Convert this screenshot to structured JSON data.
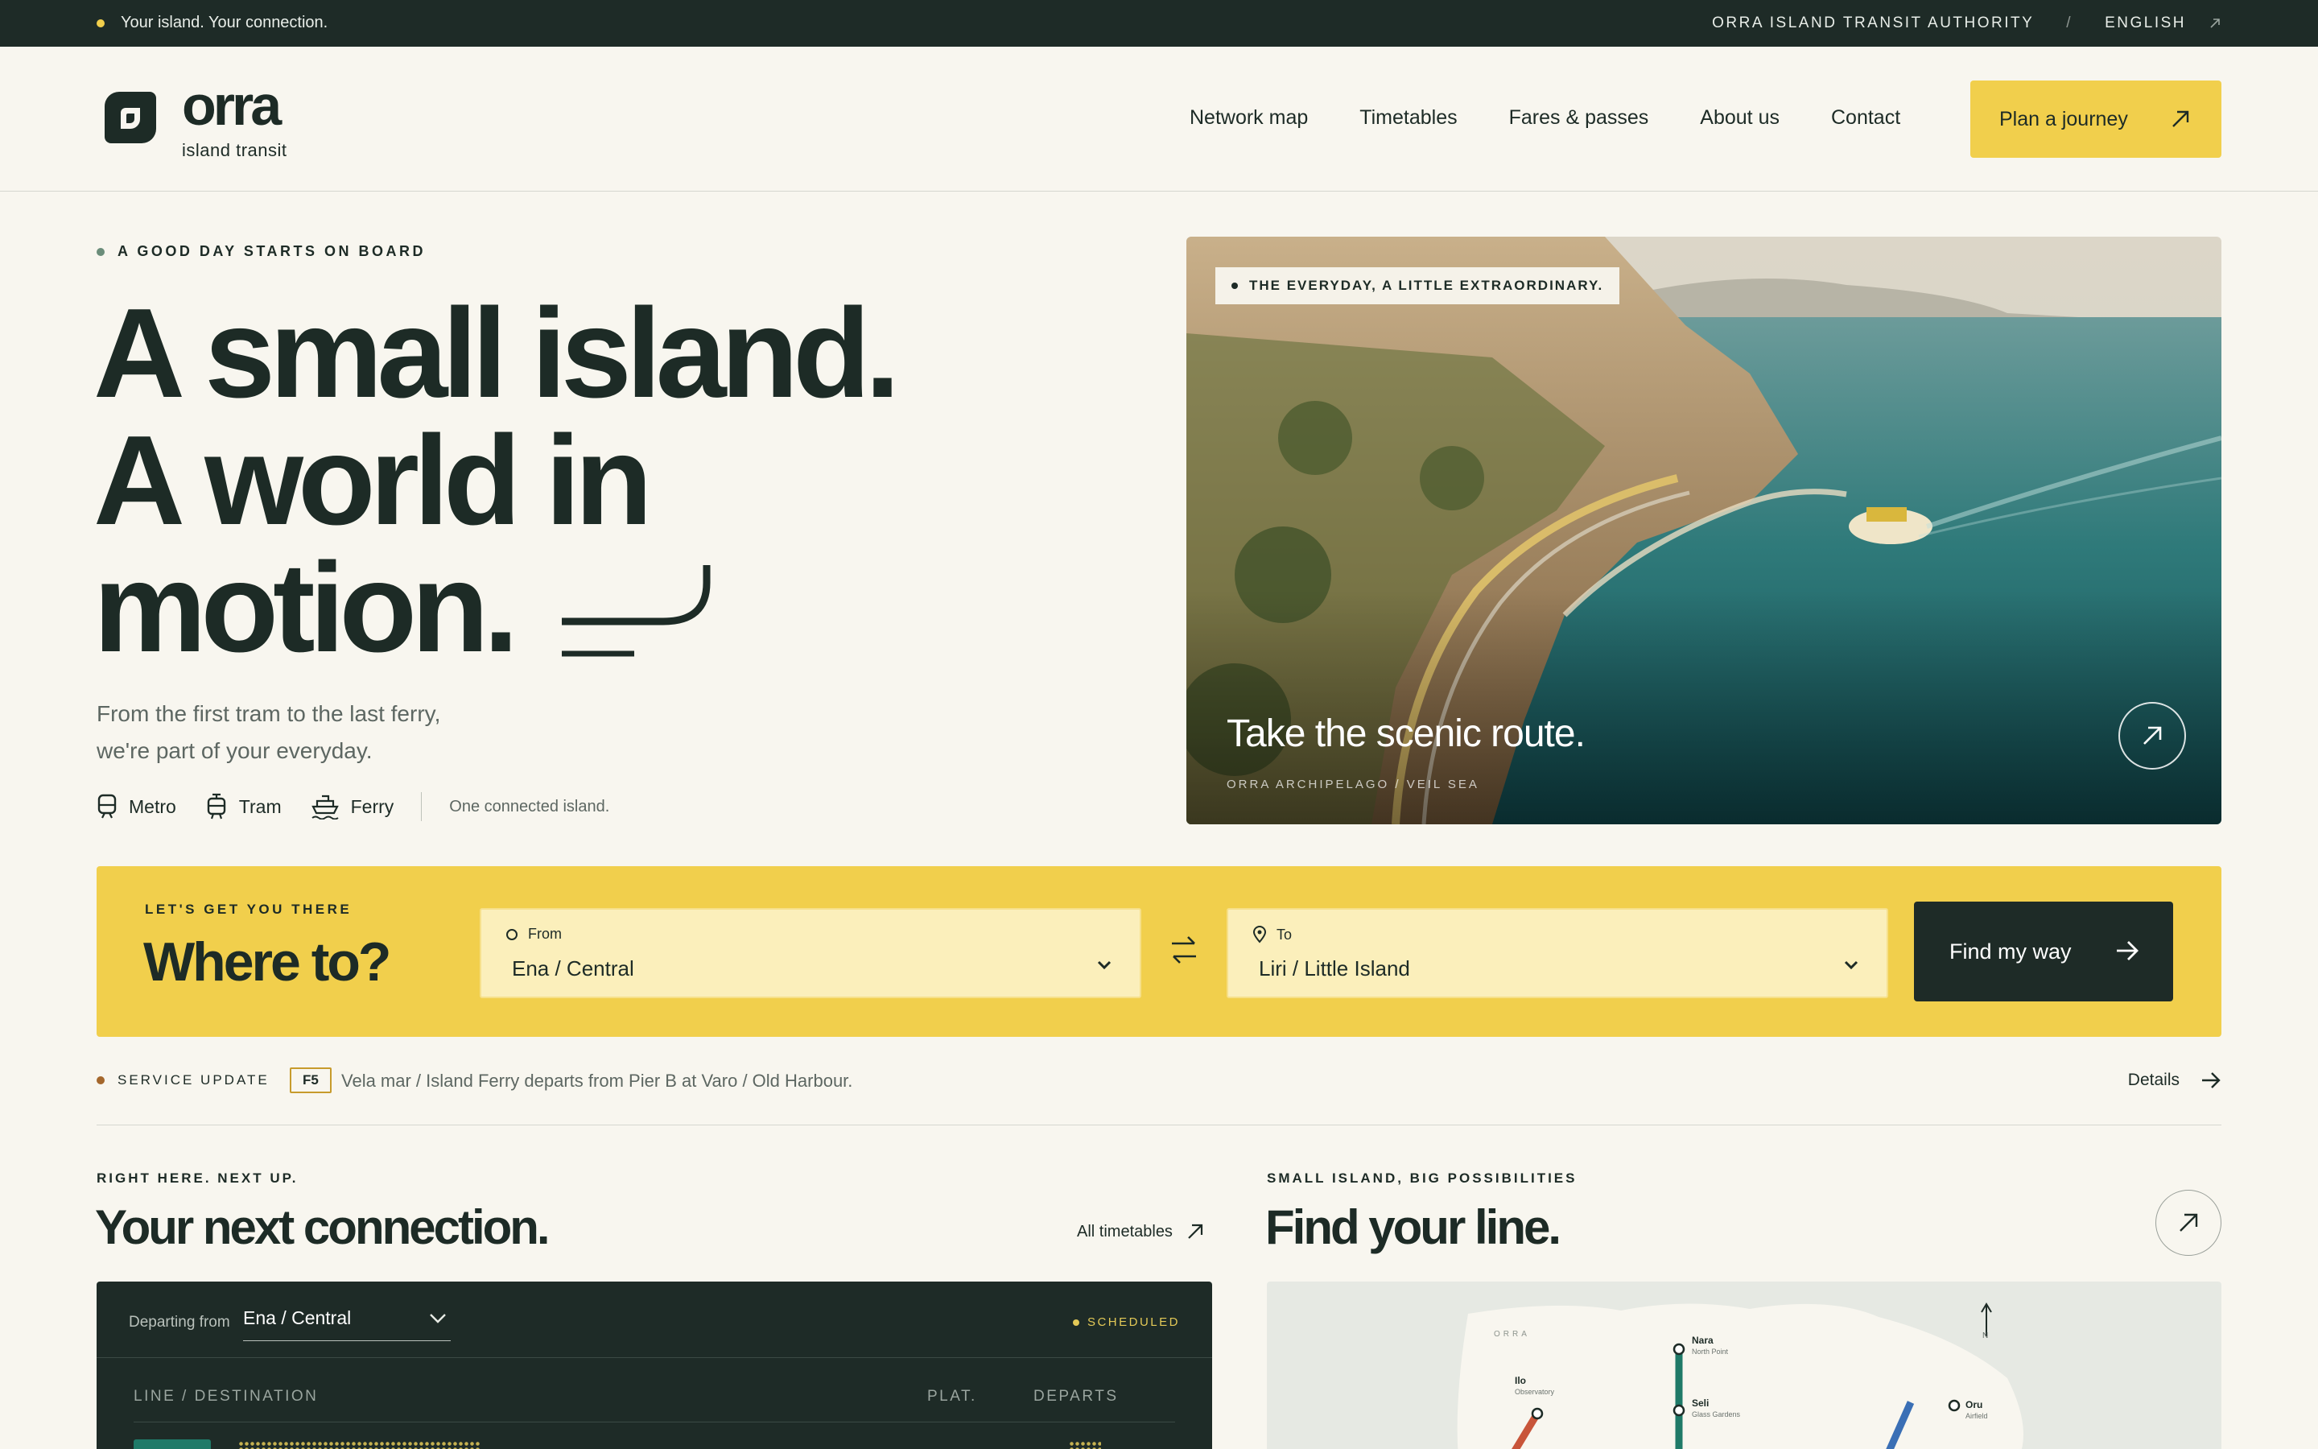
{
  "topbar": {
    "tagline": "Your island. Your connection.",
    "authority": "ORRA ISLAND TRANSIT AUTHORITY",
    "separator": "/",
    "language": "ENGLISH"
  },
  "header": {
    "brand": "orra",
    "brand_sub": "island transit",
    "nav": [
      "Network map",
      "Timetables",
      "Fares & passes",
      "About us",
      "Contact"
    ],
    "cta": "Plan a journey"
  },
  "hero": {
    "eyebrow": "A GOOD DAY STARTS ON BOARD",
    "headline_lines": [
      "A small island.",
      "A world in",
      "motion."
    ],
    "lede_lines": [
      "From the first tram to the last ferry,",
      "we're part of your everyday."
    ],
    "modes": [
      {
        "label": "Metro",
        "icon": "metro-icon"
      },
      {
        "label": "Tram",
        "icon": "tram-icon"
      },
      {
        "label": "Ferry",
        "icon": "ferry-icon"
      }
    ],
    "modes_note": "One connected island.",
    "photo": {
      "tag": "THE EVERYDAY, A LITTLE EXTRAORDINARY.",
      "title": "Take the scenic route.",
      "caption": "ORRA ARCHIPELAGO / VEIL SEA"
    }
  },
  "planner": {
    "eyebrow": "LET'S GET YOU THERE",
    "title": "Where to?",
    "from_label": "From",
    "from_value": "Ena / Central",
    "to_label": "To",
    "to_value": "Liri / Little Island",
    "submit": "Find my way"
  },
  "service_update": {
    "label": "SERVICE UPDATE",
    "code": "F5",
    "message": "Vela mar / Island Ferry departs from Pier B at Varo / Old Harbour.",
    "details": "Details"
  },
  "next_connection": {
    "eyebrow": "RIGHT HERE. NEXT UP.",
    "title": "Your next connection.",
    "all_link": "All timetables",
    "departing_label": "Departing from",
    "departing_value": "Ena / Central",
    "status": "SCHEDULED",
    "columns": [
      "LINE / DESTINATION",
      "PLAT.",
      "DEPARTS"
    ]
  },
  "find_line": {
    "eyebrow": "SMALL ISLAND, BIG POSSIBILITIES",
    "title": "Find your line.",
    "map": {
      "brand": "ORRA",
      "north": "N",
      "stations": [
        {
          "name": "Nara",
          "sub": "North Point"
        },
        {
          "name": "Ilo",
          "sub": "Observatory"
        },
        {
          "name": "Seli",
          "sub": "Glass Gardens"
        },
        {
          "name": "Oru",
          "sub": "Airfield"
        }
      ]
    }
  },
  "colors": {
    "accent_yellow": "#f1cf4c",
    "dark_green": "#1e2b27",
    "cream": "#f8f6ef",
    "line_teal": "#1f7a68",
    "line_red": "#c8553a",
    "line_blue": "#3a6fb5"
  }
}
